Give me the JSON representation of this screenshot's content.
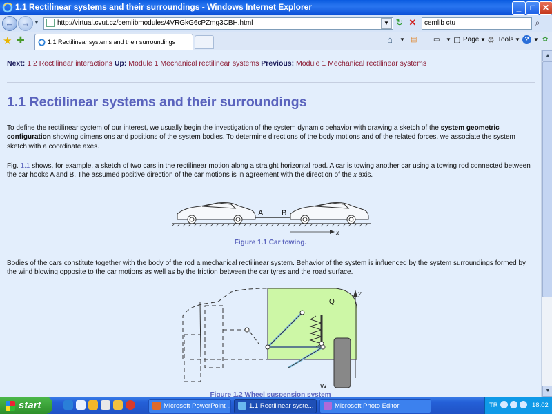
{
  "window": {
    "title": "1.1  Rectilinear systems and their surroundings - Windows Internet Explorer",
    "minimize": "_",
    "maximize": "□",
    "close": "✕"
  },
  "address_bar": {
    "back_icon": "←",
    "forward_icon": "→",
    "url": "http://virtual.cvut.cz/cemlibmodules/4VRGkG6cPZmg3CBH.html",
    "refresh_icon": "↻",
    "stop_icon": "✕",
    "search_value": "cemlib ctu",
    "search_icon": "⌕"
  },
  "tabs": {
    "active_label": "1.1  Rectilinear systems and their surroundings"
  },
  "toolbar": {
    "home_icon": "⌂",
    "feeds_icon": "▤",
    "print_icon": "▭",
    "page_label": "Page",
    "tools_label": "Tools",
    "help_icon": "?"
  },
  "page": {
    "nav": {
      "next_label": "Next:",
      "next_link": "1.2  Rectilinear interactions",
      "up_label": "Up:",
      "up_link": "Module 1  Mechanical rectilinear systems",
      "prev_label": "Previous:",
      "prev_link": "Module 1  Mechanical rectilinear systems"
    },
    "heading": "1.1 Rectilinear systems and their surroundings",
    "para1_a": "To define the rectilinear system of our interest, we usually begin the investigation of the system dynamic behavior with drawing a sketch of the ",
    "para1_bold": "system geometric configuration",
    "para1_b": " showing dimensions and positions of the system bodies. To determine directions of the body motions and of the related forces, we associate the system sketch with a coordinate axes.",
    "para2_a": "Fig. ",
    "para2_link": "1.1",
    "para2_b": " shows, for example, a sketch of two cars in the rectilinear motion along a straight horizontal road. A car is towing another car using a towing rod connected between the car hooks A and B. The assumed positive direction of the car motions is in agreement with the direction of the ",
    "para2_var": "x",
    "para2_c": " axis.",
    "fig1": {
      "label_a": "A",
      "label_b": "B",
      "label_x": "x",
      "caption": "Figure 1.1 Car towing."
    },
    "para3": "Bodies of the cars constitute together with the body of the rod a mechanical rectilinear system. Behavior of the system is influenced by the system surroundings formed by the wind blowing opposite to the car motions as well as by the friction between the car tyres and the road surface.",
    "fig2": {
      "label_y": "y",
      "label_q": "Q",
      "label_w": "W",
      "caption": "Figure 1.2 Wheel suspension system"
    }
  },
  "taskbar": {
    "start_label": "start",
    "buttons": [
      {
        "label": "Microsoft PowerPoint ..."
      },
      {
        "label": "1.1  Rectilinear syste..."
      },
      {
        "label": "Microsoft Photo Editor"
      }
    ],
    "tray_lang": "TR",
    "clock": "18:02"
  }
}
